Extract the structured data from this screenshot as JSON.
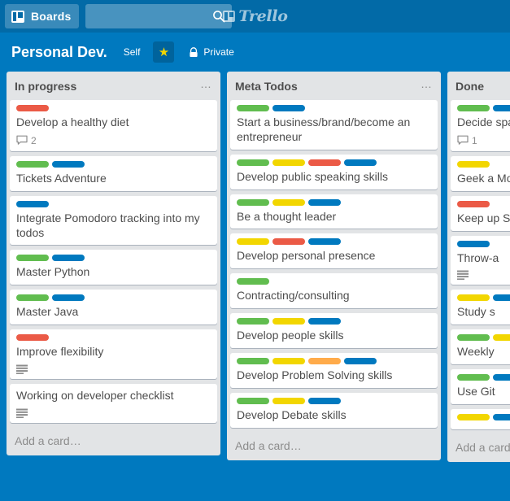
{
  "topbar": {
    "boards_button_label": "Boards",
    "search_placeholder": "",
    "search_value": "",
    "logo_text": "Trello"
  },
  "board_header": {
    "title": "Personal Dev.",
    "organization": "Self",
    "starred": true,
    "visibility": "Private"
  },
  "colors": {
    "board_background": "#0079bf",
    "topbar_background": "#026aa7",
    "list_background": "#e2e4e6",
    "card_background": "#ffffff",
    "label_green": "#61bd4f",
    "label_yellow": "#f2d600",
    "label_red": "#eb5a46",
    "label_blue": "#0079bf",
    "label_orange": "#ffab4a",
    "text_primary": "#4d4d4d",
    "text_muted": "#8c8c8c",
    "star_color": "#f2d600"
  },
  "lists": [
    {
      "title": "In progress",
      "menu_label": "…",
      "add_card_label": "Add a card…",
      "cards": [
        {
          "title": "Develop a healthy diet",
          "labels": [
            "red"
          ],
          "comments": "2",
          "description": false
        },
        {
          "title": "Tickets Adventure",
          "labels": [
            "green",
            "blue"
          ],
          "comments": null,
          "description": false
        },
        {
          "title": "Integrate Pomodoro tracking into my todos",
          "labels": [
            "blue"
          ],
          "comments": null,
          "description": false
        },
        {
          "title": "Master Python",
          "labels": [
            "green",
            "blue"
          ],
          "comments": null,
          "description": false
        },
        {
          "title": "Master Java",
          "labels": [
            "green",
            "blue"
          ],
          "comments": null,
          "description": false
        },
        {
          "title": "Improve flexibility",
          "labels": [
            "red"
          ],
          "comments": null,
          "description": true
        },
        {
          "title": "Working on developer checklist",
          "labels": [],
          "comments": null,
          "description": true
        }
      ]
    },
    {
      "title": "Meta Todos",
      "menu_label": "…",
      "add_card_label": "Add a card…",
      "cards": [
        {
          "title": "Start a business/brand/become an entrepreneur",
          "labels": [
            "green",
            "blue"
          ],
          "comments": null,
          "description": false
        },
        {
          "title": "Develop public speaking skills",
          "labels": [
            "green",
            "yellow",
            "red",
            "blue"
          ],
          "comments": null,
          "description": false
        },
        {
          "title": "Be a thought leader",
          "labels": [
            "green",
            "yellow",
            "blue"
          ],
          "comments": null,
          "description": false
        },
        {
          "title": "Develop personal presence",
          "labels": [
            "yellow",
            "red",
            "blue"
          ],
          "comments": null,
          "description": false
        },
        {
          "title": "Contracting/consulting",
          "labels": [
            "green"
          ],
          "comments": null,
          "description": false
        },
        {
          "title": "Develop people skills",
          "labels": [
            "green",
            "yellow",
            "blue"
          ],
          "comments": null,
          "description": false
        },
        {
          "title": "Develop Problem Solving skills",
          "labels": [
            "green",
            "yellow",
            "orange",
            "blue"
          ],
          "comments": null,
          "description": false
        },
        {
          "title": "Develop Debate skills",
          "labels": [
            "green",
            "yellow",
            "blue"
          ],
          "comments": null,
          "description": false
        }
      ]
    },
    {
      "title": "Done",
      "menu_label": "…",
      "add_card_label": "Add a card…",
      "cards": [
        {
          "title": "Decide space c",
          "labels": [
            "green",
            "blue"
          ],
          "comments": "1",
          "description": false
        },
        {
          "title": "Geek a Monday",
          "labels": [
            "yellow"
          ],
          "comments": null,
          "description": false
        },
        {
          "title": "Keep up Soyoka",
          "labels": [
            "red"
          ],
          "comments": null,
          "description": false
        },
        {
          "title": "Throw-a",
          "labels": [
            "blue"
          ],
          "comments": null,
          "description": true
        },
        {
          "title": "Study s",
          "labels": [
            "yellow",
            "blue"
          ],
          "comments": null,
          "description": false
        },
        {
          "title": "Weekly",
          "labels": [
            "green",
            "yellow"
          ],
          "comments": null,
          "description": false
        },
        {
          "title": "Use Git",
          "labels": [
            "green",
            "blue"
          ],
          "comments": null,
          "description": false
        },
        {
          "title": "",
          "labels": [
            "yellow",
            "blue"
          ],
          "comments": null,
          "description": false
        }
      ]
    }
  ]
}
